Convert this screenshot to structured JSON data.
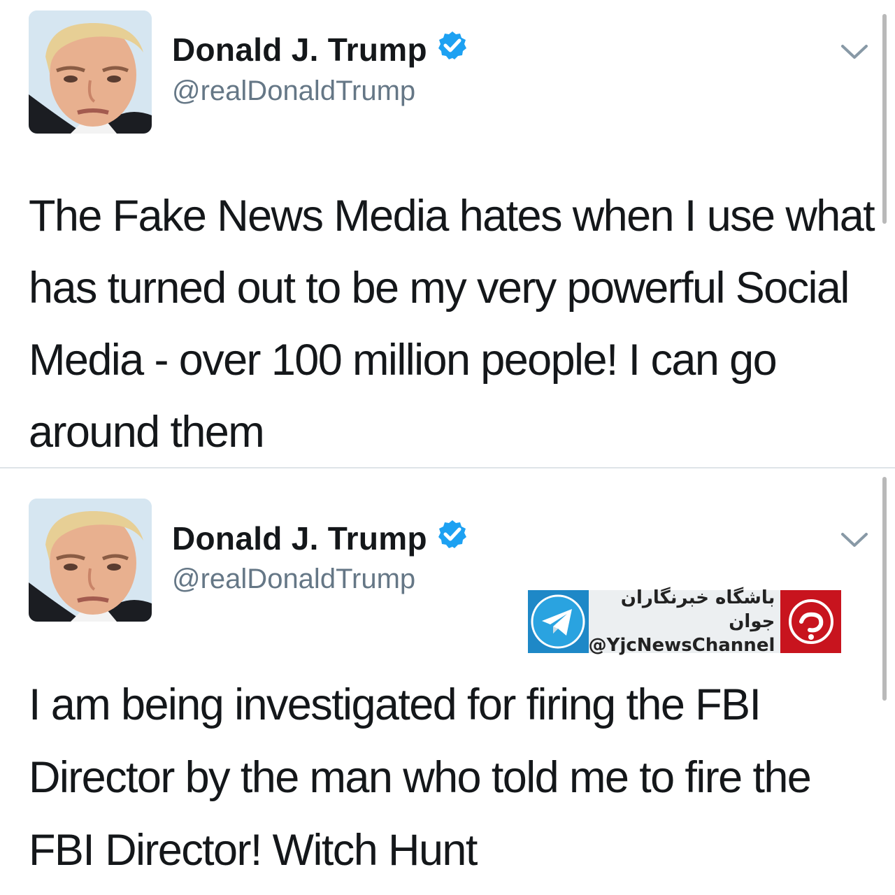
{
  "tweets": [
    {
      "author_name": "Donald J. Trump",
      "author_handle": "@realDonaldTrump",
      "text": "The Fake News Media hates when I use what has turned out to be my very powerful Social Media - over 100 million people! I can go around them"
    },
    {
      "author_name": "Donald J. Trump",
      "author_handle": "@realDonaldTrump",
      "text": "I am being investigated for firing the FBI Director by the man who told me to fire the FBI Director! Witch Hunt"
    }
  ],
  "watermark": {
    "title": "باشگاه خبرنگاران جوان",
    "channel": "@YjcNewsChannel"
  },
  "icons": {
    "verified": "verified-badge-icon",
    "menu": "chevron-down-icon",
    "telegram": "telegram-icon",
    "brand": "yjc-logo-icon"
  },
  "colors": {
    "verified": "#1da1f2",
    "handle": "#657786",
    "text": "#14171a",
    "telegram": "#1e88c7",
    "brand": "#c8141e"
  }
}
